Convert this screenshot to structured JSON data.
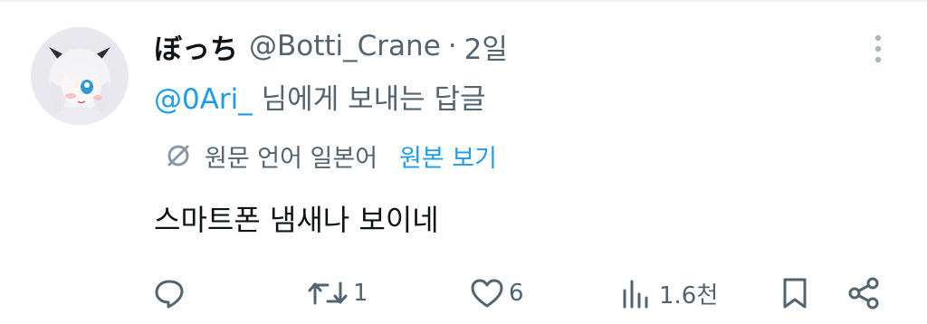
{
  "tweet": {
    "display_name": "ぼっち",
    "handle": "@Botti_Crane",
    "separator": "·",
    "time": "2일",
    "reply_mention": "@0Ari_",
    "reply_suffix": " 님에게 보내는 답글",
    "translate_note": "원문 언어 일본어",
    "translate_link": "원본 보기",
    "text": "스마트폰 냄새나 보이네"
  },
  "actions": {
    "reply_icon": "reply-icon",
    "retweet_icon": "retweet-icon",
    "retweet_count": "1",
    "like_icon": "heart-icon",
    "like_count": "6",
    "views_icon": "views-icon",
    "views_count": "1.6천",
    "bookmark_icon": "bookmark-icon",
    "share_icon": "share-icon"
  },
  "colors": {
    "accent": "#1d9bf0",
    "text_primary": "#0f1419",
    "text_secondary": "#536471"
  }
}
